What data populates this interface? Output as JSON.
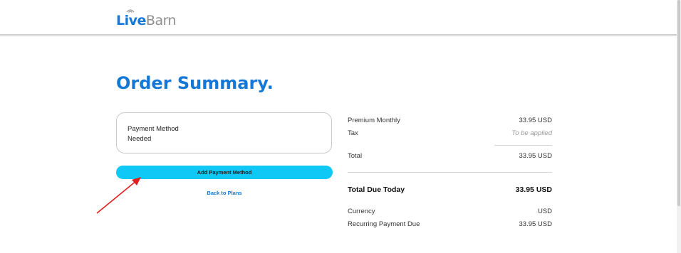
{
  "header": {
    "logo_live": "Live",
    "logo_barn": "Barn"
  },
  "page": {
    "title": "Order Summary."
  },
  "payment_card": {
    "label": "Payment Method",
    "status": "Needed"
  },
  "actions": {
    "add_payment_label": "Add Payment Method",
    "back_label": "Back to Plans"
  },
  "summary": {
    "plan_label": "Premium Monthly",
    "plan_value": "33.95 USD",
    "tax_label": "Tax",
    "tax_value": "To be applied",
    "total_label": "Total",
    "total_value": "33.95 USD",
    "due_label": "Total Due Today",
    "due_value": "33.95 USD",
    "currency_label": "Currency",
    "currency_value": "USD",
    "recurring_label": "Recurring Payment Due",
    "recurring_value": "33.95 USD"
  },
  "colors": {
    "brand_blue": "#1578d6",
    "button_cyan": "#10c8f5",
    "annotation_red": "#e02020"
  }
}
